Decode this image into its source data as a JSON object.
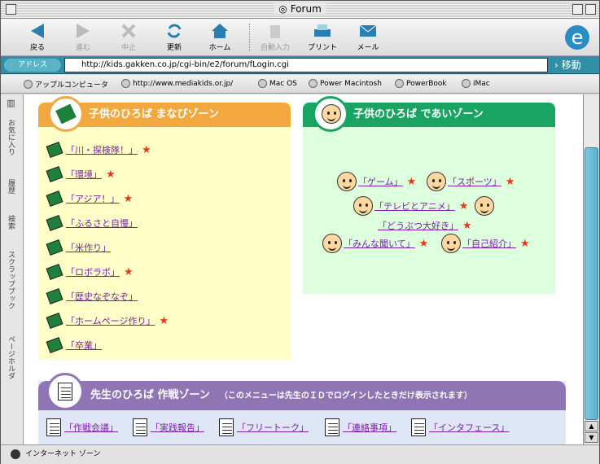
{
  "window": {
    "title": "Forum"
  },
  "toolbar": {
    "back": "戻る",
    "forward": "進む",
    "stop": "中止",
    "refresh": "更新",
    "home": "ホーム",
    "autofill": "自動入力",
    "print": "プリント",
    "mail": "メール"
  },
  "address": {
    "label": "アドレス",
    "url": "http://kids.gakken.co.jp/cgi-bin/e2/forum/fLogin.cgi",
    "go": "移動"
  },
  "favorites": [
    "アップルコンピュータ",
    "http://www.mediakids.or.jp/",
    "Mac OS",
    "Power Macintosh",
    "PowerBook",
    "iMac"
  ],
  "sidetabs": [
    "お気に入り",
    "履歴",
    "検索",
    "スクラップブック",
    "ページホルダ"
  ],
  "zone1": {
    "title": "子供のひろば まなびゾーン",
    "links": [
      {
        "label": "「川・探検隊！」",
        "star": true
      },
      {
        "label": "「環境」",
        "star": true
      },
      {
        "label": "「アジア！」",
        "star": true
      },
      {
        "label": "「ふるさと自慢」",
        "star": false
      },
      {
        "label": "「米作り」",
        "star": false
      },
      {
        "label": "「ロボラボ」",
        "star": true
      },
      {
        "label": "「歴史なぞなぞ」",
        "star": false
      },
      {
        "label": "「ホームページ作り」",
        "star": true
      },
      {
        "label": "「卒業」",
        "star": false
      }
    ]
  },
  "zone2": {
    "title": "子供のひろば であいゾーン",
    "links": [
      {
        "label": "「ゲーム」",
        "star": true
      },
      {
        "label": "「スポーツ」",
        "star": true
      },
      {
        "label": "「テレビとアニメ」",
        "star": true
      },
      {
        "label": "「どうぶつ大好き」",
        "star": true
      },
      {
        "label": "「みんな聞いて」",
        "star": true
      },
      {
        "label": "「自己紹介」",
        "star": true
      }
    ]
  },
  "zone3": {
    "title": "先生のひろば 作戦ゾーン",
    "subtitle": "（このメニューは先生のＩＤでログインしたときだけ表示されます）",
    "links": [
      "「作戦会議」",
      "「実践報告」",
      "「フリートーク」",
      "「連絡事項」",
      "「インタフェース」"
    ]
  },
  "status": {
    "text": "インターネット ゾーン"
  },
  "colors": {
    "zone1": "#f2a83e",
    "zone2": "#1aa463",
    "zone3": "#8f75b4",
    "link": "#7a1fa6",
    "star": "#e7381b"
  }
}
